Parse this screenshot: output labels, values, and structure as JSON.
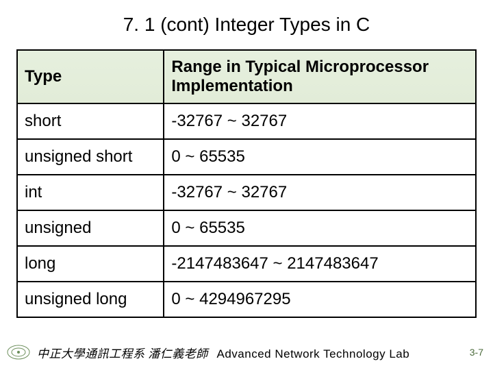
{
  "slide": {
    "title": "7. 1 (cont) Integer Types in C"
  },
  "table": {
    "headers": {
      "col1": "Type",
      "col2": "Range in Typical Microprocessor Implementation"
    },
    "rows": [
      {
        "type": "short",
        "range": "-32767 ~ 32767"
      },
      {
        "type": "unsigned short",
        "range": "0 ~ 65535"
      },
      {
        "type": "int",
        "range": "-32767 ~ 32767"
      },
      {
        "type": "unsigned",
        "range": "0 ~ 65535"
      },
      {
        "type": "long",
        "range": "-2147483647 ~ 2147483647"
      },
      {
        "type": "unsigned long",
        "range": "0 ~ 4294967295"
      }
    ]
  },
  "footer": {
    "affil_zh": "中正大學通訊工程系 潘仁義老師",
    "lab": "Advanced Network Technology Lab",
    "pagenum": "3-7"
  }
}
